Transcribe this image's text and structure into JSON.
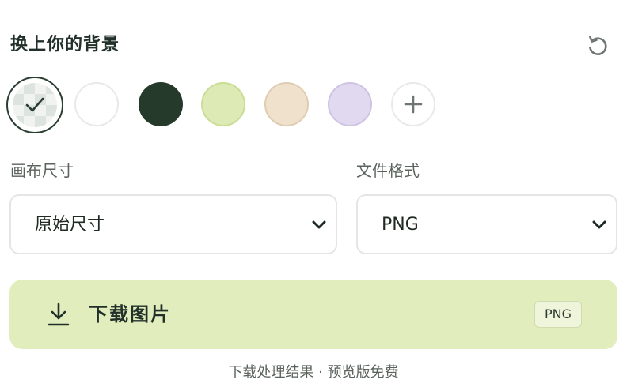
{
  "header": {
    "title": "换上你的背景",
    "reset_icon": "reset-icon"
  },
  "backgrounds": {
    "swatches": [
      {
        "name": "transparent",
        "selected": true
      },
      {
        "name": "white",
        "color": "#ffffff"
      },
      {
        "name": "dark-green",
        "color": "#263a2c"
      },
      {
        "name": "light-green",
        "color": "#ddeab5"
      },
      {
        "name": "beige",
        "color": "#efe1cc"
      },
      {
        "name": "lavender",
        "color": "#e1d9f0"
      }
    ],
    "add_icon": "plus-icon"
  },
  "canvas_size": {
    "label": "画布尺寸",
    "value": "原始尺寸"
  },
  "file_format": {
    "label": "文件格式",
    "value": "PNG"
  },
  "download": {
    "label": "下载图片",
    "badge": "PNG",
    "icon": "download-icon"
  },
  "footer": {
    "note": "下载处理结果 · 预览版免费"
  },
  "colors": {
    "accent": "#e1edbd",
    "text_dark": "#22302a",
    "text_muted": "#5b635d"
  }
}
